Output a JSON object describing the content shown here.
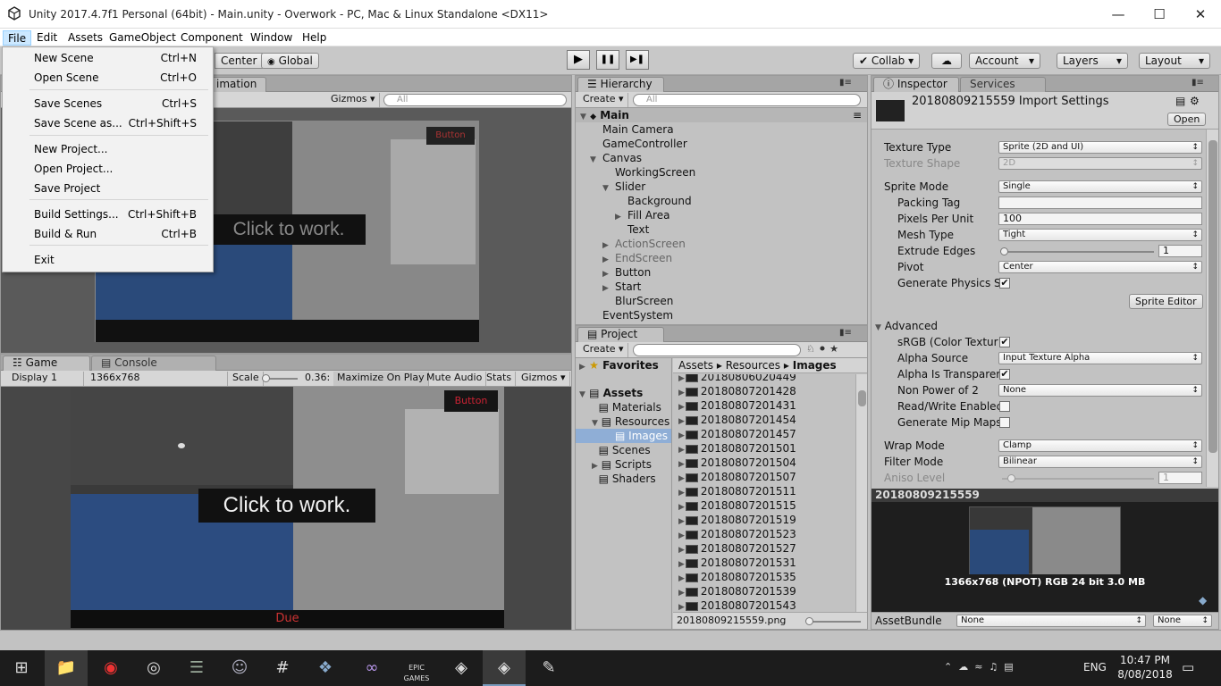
{
  "window": {
    "title": "Unity 2017.4.7f1 Personal (64bit) - Main.unity - Overwork - PC, Mac & Linux Standalone <DX11>",
    "minimize": "—",
    "maximize": "☐",
    "close": "✕"
  },
  "menu": [
    "File",
    "Edit",
    "Assets",
    "GameObject",
    "Component",
    "Window",
    "Help"
  ],
  "file_menu": [
    {
      "label": "New Scene",
      "shortcut": "Ctrl+N"
    },
    {
      "label": "Open Scene",
      "shortcut": "Ctrl+O"
    },
    {
      "label": "Save Scenes",
      "shortcut": "Ctrl+S"
    },
    {
      "label": "Save Scene as...",
      "shortcut": "Ctrl+Shift+S"
    },
    {
      "label": "New Project...",
      "shortcut": ""
    },
    {
      "label": "Open Project...",
      "shortcut": ""
    },
    {
      "label": "Save Project",
      "shortcut": ""
    },
    {
      "label": "Build Settings...",
      "shortcut": "Ctrl+Shift+B"
    },
    {
      "label": "Build & Run",
      "shortcut": "Ctrl+B"
    },
    {
      "label": "Exit",
      "shortcut": ""
    }
  ],
  "toolbar": {
    "center": "Center",
    "global": "Global",
    "play": "▶",
    "pause": "❚❚",
    "step": "▶❚",
    "collab": "Collab ▾",
    "account": "Account",
    "layers": "Layers",
    "layout": "Layout"
  },
  "scene": {
    "tab_animation": "imation",
    "gizmos": "Gizmos ▾",
    "search_placeholder": "All",
    "click_to_work": "Click to work.",
    "button_label": "Button"
  },
  "game": {
    "tab_game": "Game",
    "tab_console": "Console",
    "display": "Display 1",
    "resolution": "1366x768",
    "scale_label": "Scale",
    "scale_value": "0.36:",
    "maximize": "Maximize On Play",
    "mute": "Mute Audio",
    "stats": "Stats",
    "gizmos": "Gizmos ▾",
    "button_label": "Button",
    "click_to_work": "Click to work.",
    "due": "Due"
  },
  "hierarchy": {
    "tab": "Hierarchy",
    "create": "Create ▾",
    "search_placeholder": "All",
    "scene": "Main",
    "items": [
      {
        "label": "Main Camera",
        "indent": 0,
        "arrow": "",
        "dim": false
      },
      {
        "label": "GameController",
        "indent": 0,
        "arrow": "",
        "dim": false
      },
      {
        "label": "Canvas",
        "indent": 0,
        "arrow": "▼",
        "dim": false
      },
      {
        "label": "WorkingScreen",
        "indent": 1,
        "arrow": "",
        "dim": false
      },
      {
        "label": "Slider",
        "indent": 1,
        "arrow": "▼",
        "dim": false
      },
      {
        "label": "Background",
        "indent": 2,
        "arrow": "",
        "dim": false
      },
      {
        "label": "Fill Area",
        "indent": 2,
        "arrow": "▶",
        "dim": false
      },
      {
        "label": "Text",
        "indent": 2,
        "arrow": "",
        "dim": false
      },
      {
        "label": "ActionScreen",
        "indent": 1,
        "arrow": "▶",
        "dim": true
      },
      {
        "label": "EndScreen",
        "indent": 1,
        "arrow": "▶",
        "dim": true
      },
      {
        "label": "Button",
        "indent": 1,
        "arrow": "▶",
        "dim": false
      },
      {
        "label": "Start",
        "indent": 1,
        "arrow": "▶",
        "dim": false
      },
      {
        "label": "BlurScreen",
        "indent": 1,
        "arrow": "",
        "dim": false
      },
      {
        "label": "EventSystem",
        "indent": 0,
        "arrow": "",
        "dim": false
      }
    ]
  },
  "project": {
    "tab": "Project",
    "create": "Create ▾",
    "favorites": "Favorites",
    "assets": "Assets",
    "folders": [
      "Materials",
      "Resources",
      "Images",
      "Scenes",
      "Scripts",
      "Shaders"
    ],
    "breadcrumb": [
      "Assets",
      "Resources",
      "Images"
    ],
    "files": [
      "20180806020449",
      "20180807201428",
      "20180807201431",
      "20180807201454",
      "20180807201457",
      "20180807201501",
      "20180807201504",
      "20180807201507",
      "20180807201511",
      "20180807201515",
      "20180807201519",
      "20180807201523",
      "20180807201527",
      "20180807201531",
      "20180807201535",
      "20180807201539",
      "20180807201543"
    ],
    "selected_file": "20180809215559.png"
  },
  "inspector": {
    "tab": "Inspector",
    "tab_services": "Services",
    "title": "20180809215559 Import Settings",
    "open": "Open",
    "texture_type": {
      "label": "Texture Type",
      "value": "Sprite (2D and UI)"
    },
    "texture_shape": {
      "label": "Texture Shape",
      "value": "2D"
    },
    "sprite_mode": {
      "label": "Sprite Mode",
      "value": "Single"
    },
    "packing_tag": {
      "label": "Packing Tag",
      "value": ""
    },
    "pixels_per_unit": {
      "label": "Pixels Per Unit",
      "value": "100"
    },
    "mesh_type": {
      "label": "Mesh Type",
      "value": "Tight"
    },
    "extrude_edges": {
      "label": "Extrude Edges",
      "value": "1"
    },
    "pivot": {
      "label": "Pivot",
      "value": "Center"
    },
    "gen_physics": {
      "label": "Generate Physics S",
      "checked": "✔"
    },
    "sprite_editor": "Sprite Editor",
    "advanced": "Advanced",
    "srgb": {
      "label": "sRGB (Color Textur",
      "checked": "✔"
    },
    "alpha_source": {
      "label": "Alpha Source",
      "value": "Input Texture Alpha"
    },
    "alpha_transparency": {
      "label": "Alpha Is Transparer",
      "checked": "✔"
    },
    "npot": {
      "label": "Non Power of 2",
      "value": "None"
    },
    "read_write": {
      "label": "Read/Write Enablec",
      "checked": ""
    },
    "mipmaps": {
      "label": "Generate Mip Maps",
      "checked": ""
    },
    "wrap_mode": {
      "label": "Wrap Mode",
      "value": "Clamp"
    },
    "filter_mode": {
      "label": "Filter Mode",
      "value": "Bilinear"
    },
    "aniso": {
      "label": "Aniso Level",
      "value": "1"
    },
    "preview_title": "20180809215559",
    "preview_info": "1366x768 (NPOT)  RGB 24 bit   3.0 MB",
    "assetbundle_label": "AssetBundle",
    "assetbundle_value": "None",
    "assetbundle_variant": "None"
  },
  "taskbar": {
    "time": "10:47 PM",
    "date": "8/08/2018",
    "lang": "ENG",
    "epic": "EPIC GAMES"
  }
}
